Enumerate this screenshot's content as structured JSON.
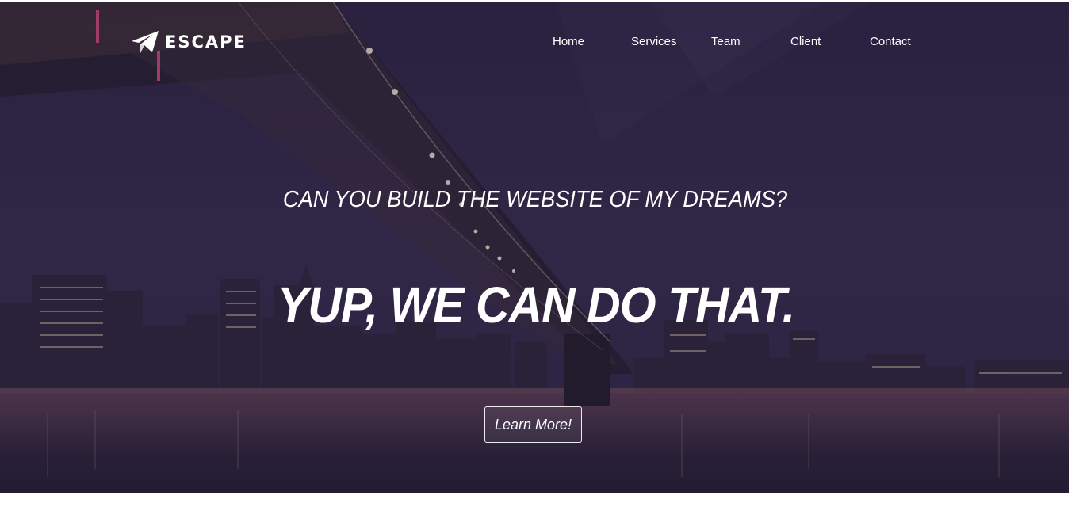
{
  "brand": {
    "name": "ESCAPE",
    "icon": "paper-plane-icon"
  },
  "nav": {
    "items": [
      {
        "label": "Home"
      },
      {
        "label": "Services"
      },
      {
        "label": "Team"
      },
      {
        "label": "Client"
      },
      {
        "label": "Contact"
      }
    ]
  },
  "hero": {
    "tagline": "CAN YOU BUILD THE WEBSITE OF MY DREAMS?",
    "headline": "YUP, WE CAN DO THAT.",
    "cta_label": "Learn More!",
    "background": "night city skyline with bridge over river"
  },
  "colors": {
    "overlay": "#2c2340",
    "text": "#ffffff"
  }
}
